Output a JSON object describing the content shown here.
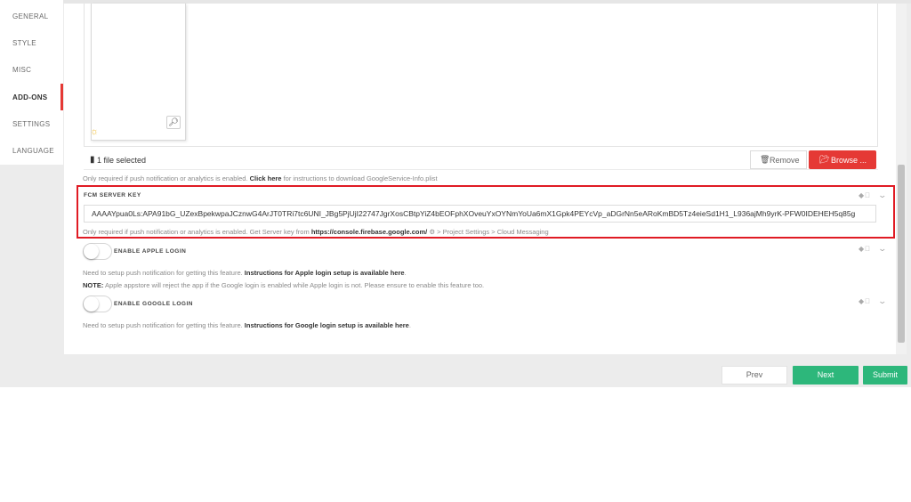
{
  "sidebar": {
    "items": [
      {
        "label": "GENERAL"
      },
      {
        "label": "STYLE"
      },
      {
        "label": "MISC"
      },
      {
        "label": "ADD-ONS"
      },
      {
        "label": "SETTINGS"
      },
      {
        "label": "LANGUAGE"
      }
    ],
    "active": "ADD-ONS"
  },
  "upload": {
    "file_status": "1 file selected",
    "remove_label": "Remove",
    "browse_label": "Browse ...",
    "helper_prefix": "Only required if push notification or analytics is enabled.",
    "helper_link": "Click here",
    "helper_suffix": "for instructions to download GoogleService-Info.plist"
  },
  "fcm": {
    "label": "FCM SERVER KEY",
    "value": "AAAAYpua0Ls:APA91bG_UZexBpekwpaJCznwG4ArJT0TRi7tc6UNI_JBg5PjUjI22747JgrXosCBtpYiZ4bEOFphXOveuYxOYNmYoUa6mX1Gpk4PEYcVp_aDGrNn5eARoKmBD5Tz4eieSd1H1_L936ajMh9yrK-PFW0IDEHEH5q85g",
    "helper_prefix": "Only required if push notification or analytics is enabled. Get Server key from",
    "helper_link": "https://console.firebase.google.com/",
    "helper_suffix": "⚙ > Project Settings > Cloud Messaging"
  },
  "apple_login": {
    "label": "ENABLE APPLE LOGIN",
    "enabled": false,
    "note1_prefix": "Need to setup push notification for getting this feature.",
    "note1_link": "Instructions for Apple login setup is available here",
    "note1_end": ".",
    "note2_label": "NOTE:",
    "note2_text": "Apple appstore will reject the app if the Google login is enabled while Apple login is not. Please ensure to enable this feature too."
  },
  "google_login": {
    "label": "ENABLE GOOGLE LOGIN",
    "enabled": false,
    "note_prefix": "Need to setup push notification for getting this feature.",
    "note_link": "Instructions for Google login setup is available here",
    "note_end": "."
  },
  "footer": {
    "prev_label": "Prev",
    "next_label": "Next",
    "submit_label": "Submit"
  },
  "colors": {
    "accent_red": "#e53935",
    "highlight_border": "#e01b24",
    "primary_green": "#2db77b"
  },
  "icons": {
    "platform": "android-apple-icons",
    "expand": "chevron-down-icon",
    "zoom": "zoom-in-icon",
    "file": "file-icon",
    "trash": "trash-icon",
    "folder": "folder-open-icon"
  }
}
